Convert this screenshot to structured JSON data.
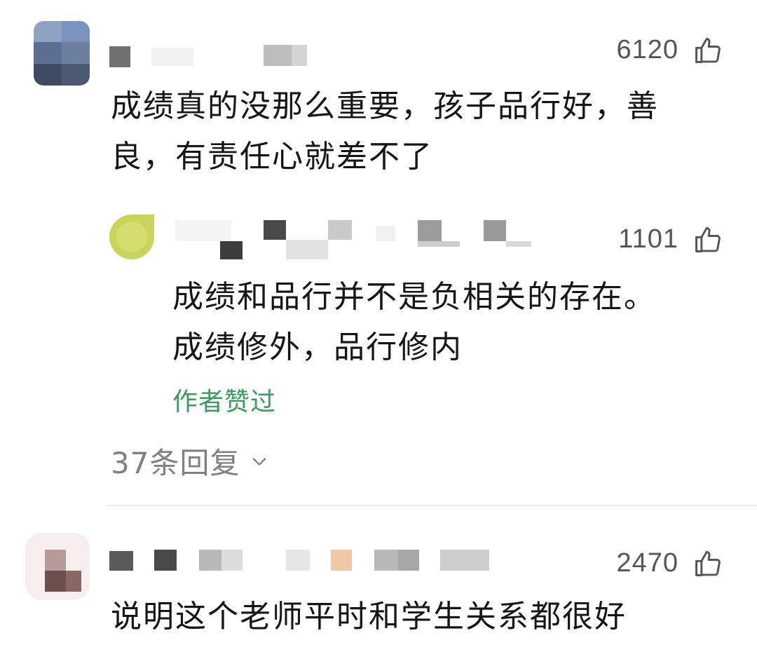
{
  "comments": [
    {
      "likes": "6120",
      "text_line1": "成绩真的没那么重要，孩子品行好，善",
      "text_line2": "良，有责任心就差不了",
      "like_icon": "thumbs-up-icon",
      "reply": {
        "likes": "1101",
        "text_line1": "成绩和品行并不是负相关的存在。",
        "text_line2": "成绩修外，品行修内",
        "badge": "作者赞过",
        "like_icon": "thumbs-up-icon"
      },
      "replies_label": "37条回复",
      "expand_icon": "chevron-down-icon"
    },
    {
      "likes": "2470",
      "text_line1": "说明这个老师平时和学生关系都很好",
      "like_icon": "thumbs-up-icon"
    }
  ],
  "colors": {
    "author_badge": "#3a9b5c",
    "muted_text": "#808080",
    "like_count": "#555555"
  }
}
